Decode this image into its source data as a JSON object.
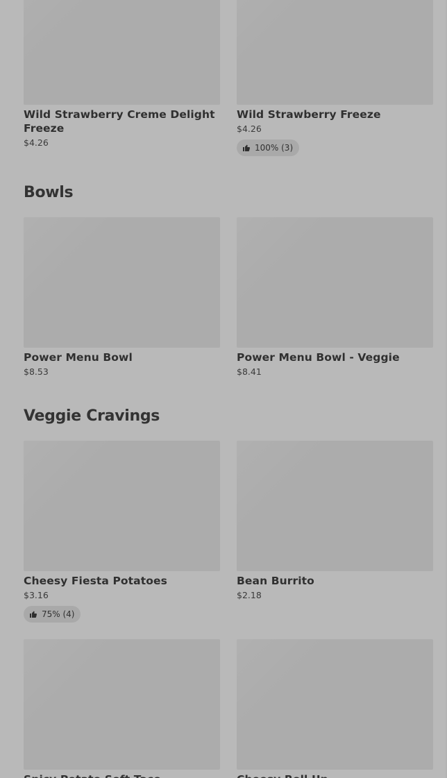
{
  "top_items": [
    {
      "name": "Wild Strawberry Creme Delight Freeze",
      "price": "$4.26",
      "rating": ""
    },
    {
      "name": "Wild Strawberry Freeze",
      "price": "$4.26",
      "rating": "100% (3)"
    }
  ],
  "sections": [
    {
      "title": "Bowls",
      "items": [
        {
          "name": "Power Menu Bowl",
          "price": "$8.53",
          "rating": ""
        },
        {
          "name": "Power Menu Bowl - Veggie",
          "price": "$8.41",
          "rating": ""
        }
      ]
    },
    {
      "title": "Veggie Cravings",
      "items": [
        {
          "name": "Cheesy Fiesta Potatoes",
          "price": "$3.16",
          "rating": "75% (4)"
        },
        {
          "name": "Bean Burrito",
          "price": "$2.18",
          "rating": ""
        },
        {
          "name": "Spicy Potato Soft Taco",
          "price": "",
          "rating": ""
        },
        {
          "name": "Cheesy Roll Up",
          "price": "",
          "rating": ""
        }
      ]
    }
  ],
  "icons": {
    "thumbs_up": "thumbs-up-icon"
  },
  "colors": {
    "background": "#b9b9b9",
    "image_placeholder": "#acacac",
    "rating_pill": "#a9a9a9"
  }
}
